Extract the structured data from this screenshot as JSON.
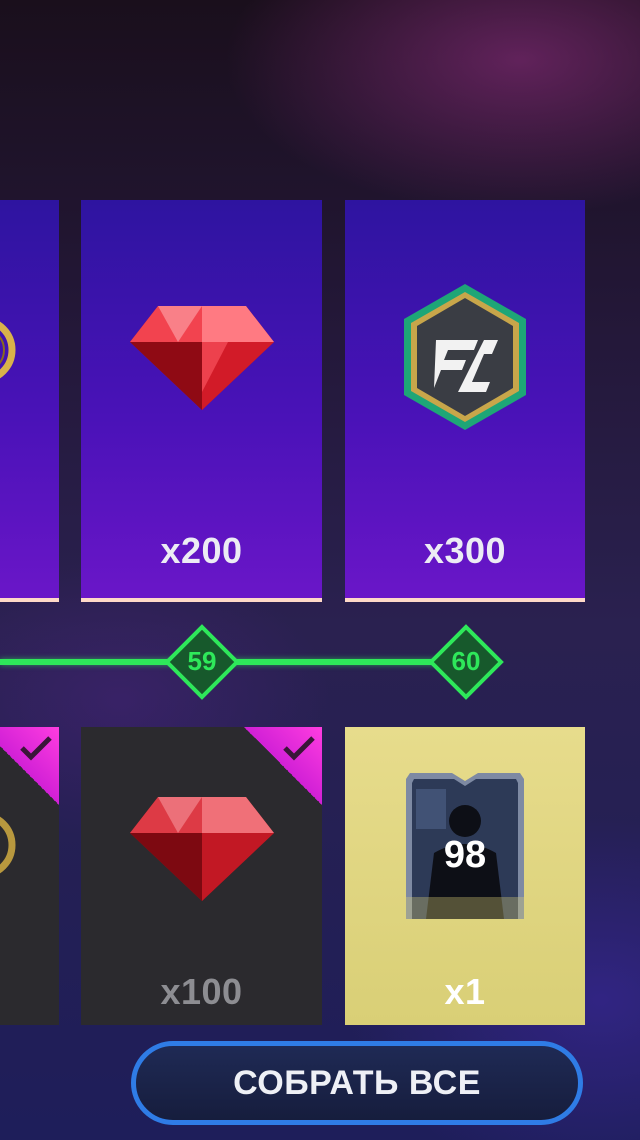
{
  "premium_row": [
    {
      "reward": "coins",
      "icon": "coin-icon",
      "quantity": ""
    },
    {
      "reward": "gems",
      "icon": "ruby-gem-icon",
      "quantity": "x200"
    },
    {
      "reward": "fc-points",
      "icon": "fc-points-icon",
      "quantity": "x300"
    }
  ],
  "progress": {
    "levels": [
      "59",
      "60"
    ],
    "track_color": "#2ee85a"
  },
  "free_row": [
    {
      "reward": "coins",
      "icon": "coin-icon",
      "quantity": "",
      "claimed": true
    },
    {
      "reward": "gems",
      "icon": "ruby-gem-icon",
      "quantity": "x100",
      "claimed": true
    },
    {
      "reward": "player",
      "icon": "player-card-icon",
      "quantity": "x1",
      "claimed": false,
      "player_rating": "98"
    }
  ],
  "collect_button": {
    "label": "СОБРАТЬ ВСЕ"
  },
  "colors": {
    "premium_card": "#4a12b8",
    "free_card": "#2b2a2e",
    "gold_card": "#e0d57f",
    "claimed_corner": "#e52ae0",
    "button_border": "#2f7ce6"
  }
}
